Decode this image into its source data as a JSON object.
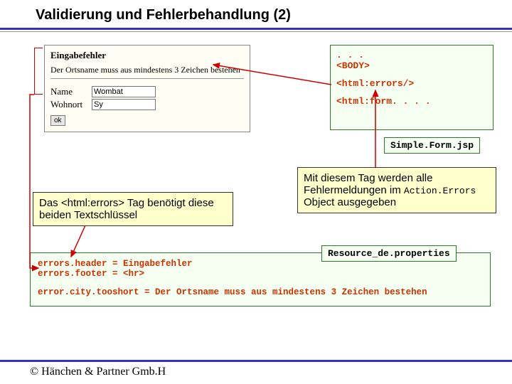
{
  "title": "Validierung und Fehlerbehandlung (2)",
  "form": {
    "error_title": "Eingabefehler",
    "error_msg": "Der Ortsname muss aus mindestens 3 Zeichen bestehen",
    "name_label": "Name",
    "name_value": "Wombat",
    "city_label": "Wohnort",
    "city_value": "Sy",
    "submit_label": "ok"
  },
  "jsp": {
    "line1": ". . .",
    "line2": "<BODY>",
    "line3": "<html:errors/>",
    "line4": "<html:form. . . .",
    "filename": "Simple.Form.jsp"
  },
  "note_left": "Das <html:errors> Tag benötigt diese beiden Textschlüssel",
  "note_right_1": "Mit diesem Tag werden alle Fehlermeldungen im ",
  "note_right_mono": "Action.Errors",
  "note_right_2": " Object ausgegeben",
  "props": {
    "header": "errors.header = Eingabefehler",
    "footer_line": "errors.footer = <hr>",
    "tooshort": "error.city.tooshort = Der Ortsname muss aus mindestens 3 Zeichen bestehen",
    "filename": "Resource_de.properties"
  },
  "footer": "© Hänchen & Partner Gmb.H"
}
